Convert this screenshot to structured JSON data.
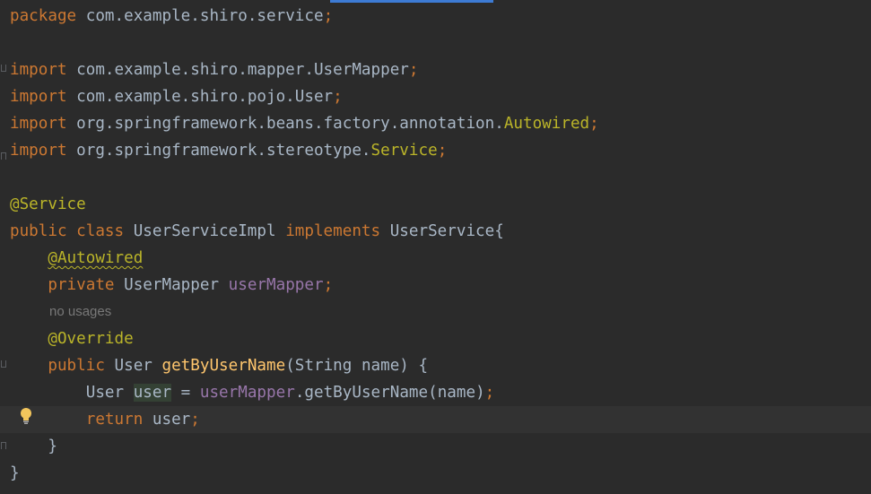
{
  "editor": {
    "language": "java",
    "theme_colors": {
      "background": "#2b2b2b",
      "caret_row": "#323232",
      "keyword": "#cc7832",
      "annotation": "#bbb529",
      "field": "#9876aa",
      "method": "#ffc66d",
      "text": "#a9b7c6",
      "hint": "#787878",
      "scrollbar_indicator": "#3d7bd4"
    },
    "intention_icon": "lightbulb-icon"
  },
  "code": {
    "l1_kw": "package",
    "l1_rest": " com.example.shiro.service",
    "l1_semi": ";",
    "l3_kw": "import",
    "l3_rest": " com.example.shiro.mapper.UserMapper",
    "l3_semi": ";",
    "l4_kw": "import",
    "l4_rest": " com.example.shiro.pojo.User",
    "l4_semi": ";",
    "l5_kw": "import",
    "l5_rest": " org.springframework.beans.factory.annotation.",
    "l5_ann": "Autowired",
    "l5_semi": ";",
    "l6_kw": "import",
    "l6_rest": " org.springframework.stereotype.",
    "l6_ann": "Service",
    "l6_semi": ";",
    "l8_ann": "@Service",
    "l9_kw1": "public class",
    "l9_name": " UserServiceImpl ",
    "l9_kw2": "implements",
    "l9_rest": " UserService{",
    "l10_ann": "@Autowired",
    "l11_kw": "private",
    "l11_type": " UserMapper ",
    "l11_field": "userMapper",
    "l11_semi": ";",
    "hint": "no usages",
    "l12_ann": "@Override",
    "l13_kw": "public",
    "l13_type": " User ",
    "l13_fn": "getByUserName",
    "l13_rest": "(String name) {",
    "l14_type": "User ",
    "l14_var": "user",
    "l14_eq": " = ",
    "l14_field": "userMapper",
    "l14_rest": ".getByUserName(name)",
    "l14_semi": ";",
    "l15_kw": "return",
    "l15_rest": " user",
    "l15_semi": ";",
    "l16_close": "}",
    "l17_close": "}"
  }
}
